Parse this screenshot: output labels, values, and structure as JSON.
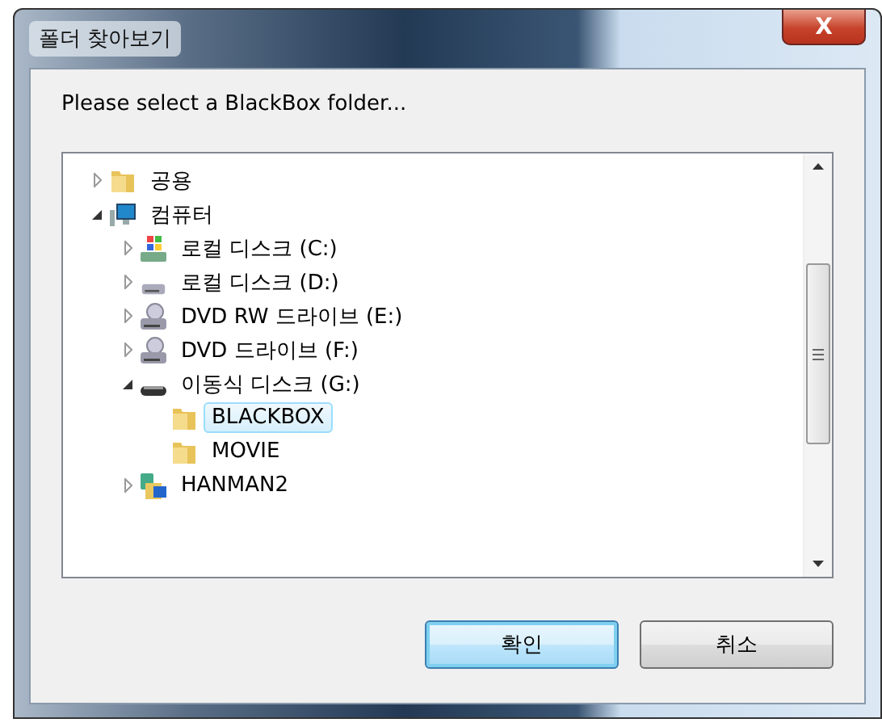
{
  "window": {
    "title": "폴더 찾아보기",
    "close_button": "X"
  },
  "message": "Please select a BlackBox folder...",
  "tree": [
    {
      "label": "공용",
      "kind": "folder",
      "expanded": false,
      "selected": false
    },
    {
      "label": "컴퓨터",
      "kind": "computer",
      "expanded": true,
      "selected": false,
      "children": [
        {
          "label": "로컬 디스크 (C:)",
          "kind": "system-disk",
          "expanded": false,
          "selected": false
        },
        {
          "label": "로컬 디스크 (D:)",
          "kind": "hard-disk",
          "expanded": false,
          "selected": false
        },
        {
          "label": "DVD RW 드라이브 (E:)",
          "kind": "optical-drive",
          "expanded": false,
          "selected": false
        },
        {
          "label": "DVD 드라이브 (F:)",
          "kind": "optical-drive",
          "expanded": false,
          "selected": false
        },
        {
          "label": "이동식 디스크 (G:)",
          "kind": "removable-disk",
          "expanded": true,
          "selected": false,
          "children": [
            {
              "label": "BLACKBOX",
              "kind": "folder",
              "selected": true
            },
            {
              "label": "MOVIE",
              "kind": "folder",
              "selected": false
            }
          ]
        },
        {
          "label": "HANMAN2",
          "kind": "network",
          "expanded": false,
          "selected": false
        }
      ]
    }
  ],
  "buttons": [
    {
      "label": "확인",
      "default": true
    },
    {
      "label": "취소",
      "default": false
    }
  ]
}
